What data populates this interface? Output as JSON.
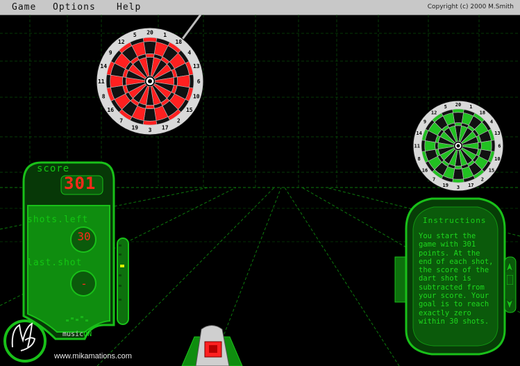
{
  "menu": {
    "items": [
      "Game",
      "Options",
      "Help"
    ],
    "copyright": "Copyright (c) 2000  M.Smith"
  },
  "score_panel": {
    "score_label": "score",
    "score_value": "301",
    "shots_left_label": "shots.left",
    "shots_left_value": "30",
    "last_shot_label": "last.shot",
    "last_shot_value": "-",
    "music_label": "music",
    "music_state": "ON"
  },
  "instructions": {
    "title": "Instructions",
    "text": "You start the game with 301 points. At the end of each shot, the score of the dart shot is subtracted from your score. Your goal is to reach exactly zero within 30 shots."
  },
  "footer": {
    "url": "www.mikamations.com"
  },
  "dartboard_numbers": [
    "20",
    "1",
    "18",
    "4",
    "13",
    "6",
    "10",
    "15",
    "2",
    "17",
    "3",
    "19",
    "7",
    "16",
    "8",
    "11",
    "14",
    "9",
    "12",
    "5"
  ],
  "colors": {
    "background": "#000000",
    "panel_green": "#1fd01f",
    "panel_dark_green": "#0a5a0a",
    "lcd_red": "#ff2a1a",
    "target_board_red": "#ff2020",
    "practice_board_green": "#21c021",
    "menubar": "#c8c8c8"
  },
  "icons": {
    "logo": "ms-signature-logo",
    "dart_launcher": "dart-launcher-icon",
    "scroll_up": "scroll-up-arrow-icon",
    "scroll_down": "scroll-down-arrow-icon"
  }
}
